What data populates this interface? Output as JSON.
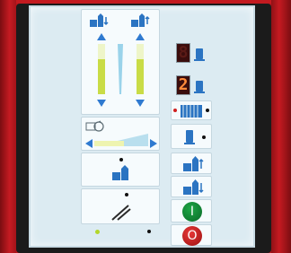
{
  "left_column": {
    "level_top": {
      "icon_down": "bin-unload-down-icon",
      "icon_up": "bin-load-up-icon"
    },
    "bars": [
      {
        "name": "left-level-bar",
        "level": 0.7
      },
      {
        "name": "right-level-bar",
        "level": 0.7
      }
    ],
    "dryer_cycle": {
      "icon": "cycle-icon",
      "slider_level": 0.55
    },
    "buttons": [
      {
        "name": "bin-select-button",
        "icon": "bin-icon",
        "indicator": "off"
      },
      {
        "name": "sweep-button",
        "icon": "sweep-icon",
        "indicator": "off"
      }
    ],
    "bottom_indicators": [
      {
        "name": "bottom-led-left",
        "color": "#b3d62b"
      },
      {
        "name": "bottom-led-right",
        "color": "#1b1b1b"
      }
    ]
  },
  "right_column": {
    "displays": [
      {
        "name": "display-upper",
        "digit": "8",
        "state": "dim"
      },
      {
        "name": "display-lower",
        "digit": "2",
        "state": "on"
      }
    ],
    "buttons": [
      {
        "name": "auger-button",
        "icon": "auger-icon"
      },
      {
        "name": "pipe-button",
        "icon": "pipe-icon"
      },
      {
        "name": "fill-up-button",
        "icon": "bin-up-icon"
      },
      {
        "name": "fill-down-button",
        "icon": "bin-down-icon"
      }
    ],
    "start_label": "I",
    "stop_label": "O",
    "colors": {
      "start": "#0a8a34",
      "stop": "#c61b1b"
    }
  }
}
